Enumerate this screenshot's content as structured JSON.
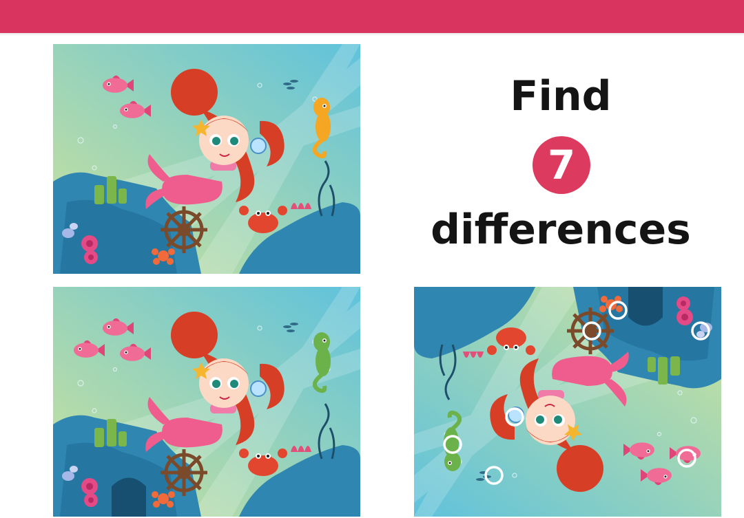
{
  "header": {
    "bar_color": "#d9335f"
  },
  "title": {
    "line1": "Find",
    "number": "7",
    "line2": "differences",
    "badge_color": "#dc3a5f"
  },
  "panels": [
    {
      "name": "original",
      "variant": "a",
      "orientation": "upright"
    },
    {
      "name": "modified",
      "variant": "b",
      "orientation": "upright"
    },
    {
      "name": "answer-key",
      "variant": "b",
      "orientation": "upside-down",
      "highlighted_differences": 7
    }
  ],
  "scene": {
    "water_top": "#5fc2dc",
    "water_bottom": "#cfe39a",
    "rock_color": "#2f86b0",
    "mermaid_hair": "#d63f26",
    "mermaid_tail": "#ef5c8e",
    "seahorse_color_a": "#f5a623",
    "seahorse_color_b": "#6bb24a",
    "crab_color": "#e2462e",
    "wheel_color": "#7a4a2a",
    "marker_color": "#ffffff"
  }
}
